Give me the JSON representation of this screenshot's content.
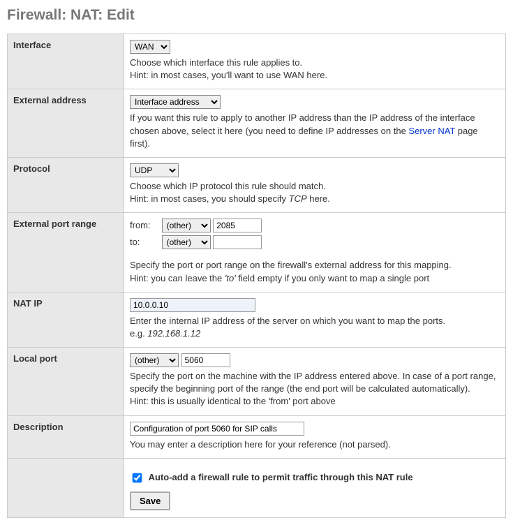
{
  "page_title": "Firewall: NAT: Edit",
  "rows": {
    "interface": {
      "label": "Interface",
      "value": "WAN",
      "help1": "Choose which interface this rule applies to.",
      "help2": "Hint: in most cases, you'll want to use WAN here."
    },
    "ext_address": {
      "label": "External address",
      "value": "Interface address",
      "help_pre": "If you want this rule to apply to another IP address than the IP address of the interface chosen above, select it here (you need to define IP addresses on the ",
      "link_text": "Server NAT",
      "help_post": " page first)."
    },
    "protocol": {
      "label": "Protocol",
      "value": "UDP",
      "help1": "Choose which IP protocol this rule should match.",
      "hint_pre": "Hint: in most cases, you should specify ",
      "hint_em": "TCP",
      "hint_post": " here."
    },
    "ext_port": {
      "label": "External port range",
      "from_label": "from:",
      "from_sel": "(other)",
      "from_val": "2085",
      "to_label": "to:",
      "to_sel": "(other)",
      "to_val": "",
      "help1": "Specify the port or port range on the firewall's external address for this mapping.",
      "hint_pre": "Hint: you can leave the ",
      "hint_em": "'to'",
      "hint_post": " field empty if you only want to map a single port"
    },
    "nat_ip": {
      "label": "NAT IP",
      "value": "10.0.0.10",
      "help1": "Enter the internal IP address of the server on which you want to map the ports.",
      "eg_pre": "e.g. ",
      "eg_em": "192.168.1.12"
    },
    "local_port": {
      "label": "Local port",
      "sel": "(other)",
      "value": "5060",
      "help1": "Specify the port on the machine with the IP address entered above. In case of a port range, specify the beginning port of the range (the end port will be calculated automatically).",
      "help2": "Hint: this is usually identical to the 'from' port above"
    },
    "description": {
      "label": "Description",
      "value": "Configuration of port 5060 for SIP calls",
      "help": "You may enter a description here for your reference (not parsed)."
    },
    "auto_add": {
      "checked": true,
      "label": "Auto-add a firewall rule to permit traffic through this NAT rule"
    },
    "save_label": "Save"
  }
}
